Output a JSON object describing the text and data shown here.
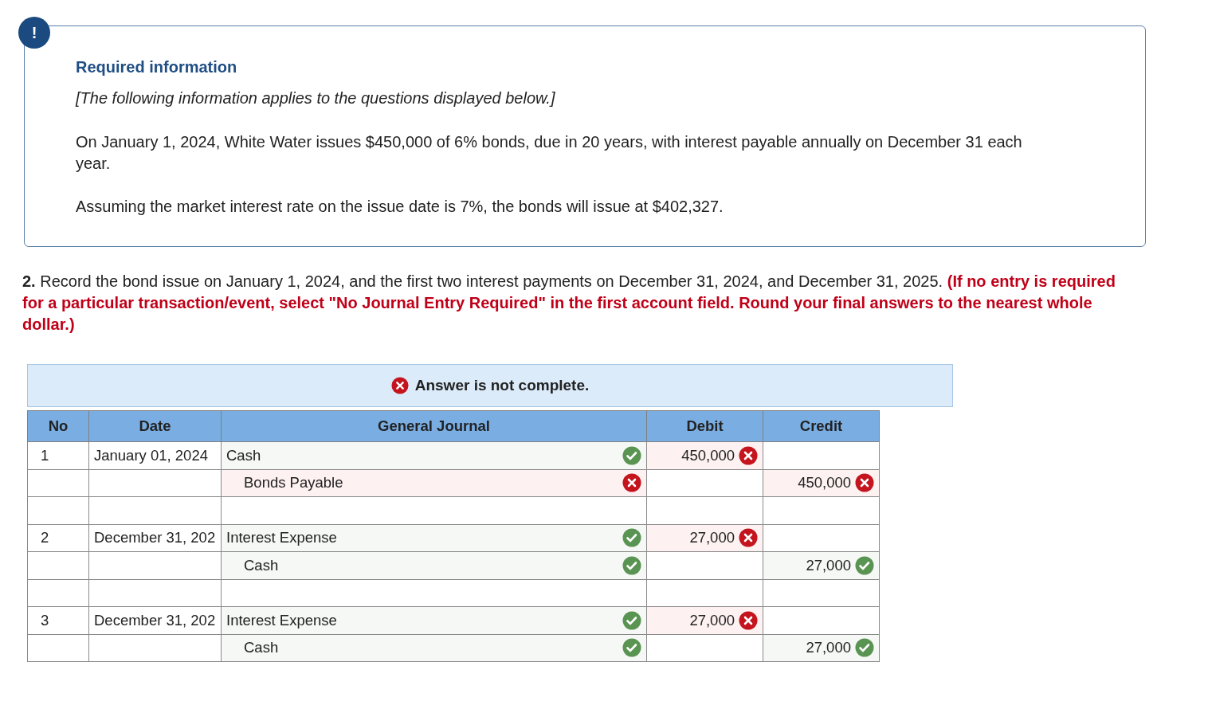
{
  "info": {
    "badge": "!",
    "title": "Required information",
    "note": "[The following information applies to the questions displayed below.]",
    "paragraphs": [
      "On January 1, 2024, White Water issues $450,000 of 6% bonds, due in 20 years, with interest payable annually on December 31 each year.",
      "Assuming the market interest rate on the issue date is 7%, the bonds will issue at $402,327."
    ]
  },
  "question": {
    "text": "**2.** Record the bond issue on January 1, 2024, and the first two interest payments on December 31, 2024, and December 31, 2025. ",
    "instruction": "(If no entry is required for a particular transaction/event, select \"No Journal Entry Required\" in the first account field. Round your final answers to the nearest whole dollar.)"
  },
  "banner": {
    "complete": false,
    "text": "Answer is not complete."
  },
  "table": {
    "columns": [
      "No",
      "Date",
      "General Journal",
      "Debit",
      "Credit"
    ],
    "rows": [
      {
        "kind": "entry",
        "no": "1",
        "date": "January 01, 2024",
        "account": "Cash",
        "indented": false,
        "account_correct": true,
        "debit": "450,000",
        "debit_correct": false
      },
      {
        "kind": "entry",
        "account": "Bonds Payable",
        "indented": true,
        "account_correct": false,
        "credit": "450,000",
        "credit_correct": false
      },
      {
        "kind": "blank"
      },
      {
        "kind": "entry",
        "no": "2",
        "date": "December 31, 202",
        "account": "Interest Expense",
        "indented": false,
        "account_correct": true,
        "debit": "27,000",
        "debit_correct": false
      },
      {
        "kind": "entry",
        "account": "Cash",
        "indented": true,
        "account_correct": true,
        "credit": "27,000",
        "credit_correct": true
      },
      {
        "kind": "blank"
      },
      {
        "kind": "entry",
        "no": "3",
        "date": "December 31, 202",
        "account": "Interest Expense",
        "indented": false,
        "account_correct": true,
        "debit": "27,000",
        "debit_correct": false
      },
      {
        "kind": "entry",
        "account": "Cash",
        "indented": true,
        "account_correct": true,
        "credit": "27,000",
        "credit_correct": true
      }
    ]
  }
}
